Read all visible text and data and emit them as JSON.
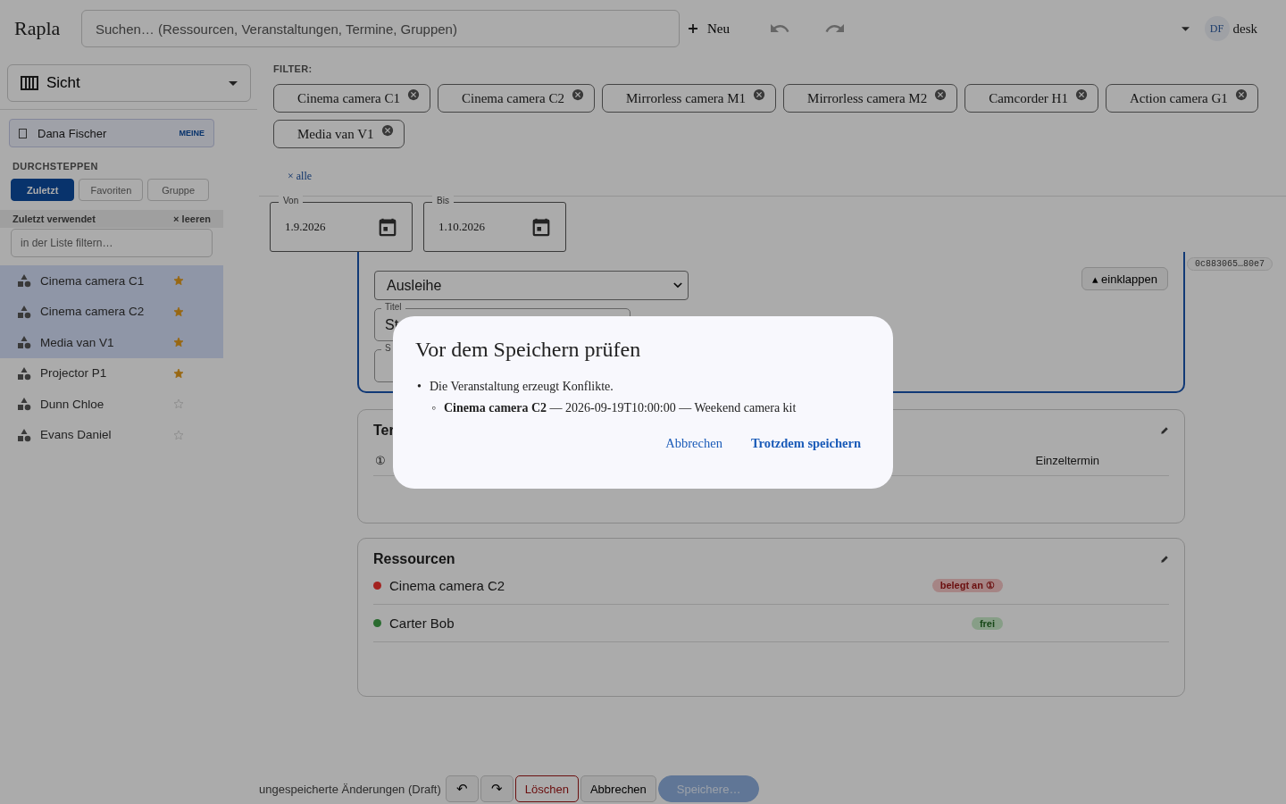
{
  "app": {
    "logo": "Rapla",
    "search_placeholder": "Suchen… (Ressourcen, Veranstaltungen, Termine, Gruppen)",
    "new_label": "Neu",
    "user_initials": "DF",
    "user_name": "desk"
  },
  "sidebar": {
    "view_label": "Sicht",
    "owner": {
      "name": "Dana Fischer",
      "badge": "MEINE",
      "checked": false
    },
    "browse_heading": "DURCHSTEPPEN",
    "browse_tabs": [
      {
        "label": "Zuletzt",
        "selected": true
      },
      {
        "label": "Favoriten",
        "selected": false
      },
      {
        "label": "Gruppe",
        "selected": false
      }
    ],
    "list_heading": "Zuletzt verwendet",
    "clear_label": "× leeren",
    "filter_placeholder": "in der Liste filtern…",
    "items": [
      {
        "name": "Cinema camera C1",
        "selected": true,
        "favorite": true
      },
      {
        "name": "Cinema camera C2",
        "selected": true,
        "favorite": true
      },
      {
        "name": "Media van V1",
        "selected": true,
        "favorite": true
      },
      {
        "name": "Projector P1",
        "selected": false,
        "favorite": true
      },
      {
        "name": "Dunn Chloe",
        "selected": false,
        "favorite": false
      },
      {
        "name": "Evans Daniel",
        "selected": false,
        "favorite": false
      }
    ]
  },
  "filter": {
    "heading": "FILTER:",
    "chips": [
      "Cinema camera C1",
      "Cinema camera C2",
      "Mirrorless camera M1",
      "Mirrorless camera M2",
      "Camcorder H1",
      "Action camera G1",
      "Media van V1"
    ],
    "clear_all": "× alle"
  },
  "dates": [
    {
      "label": "Von",
      "value": "1.9.2026"
    },
    {
      "label": "Bis",
      "value": "1.10.2026"
    }
  ],
  "editor": {
    "type_value": "Ausleihe",
    "title_label": "Titel",
    "title_value": "St",
    "field3_label": "S",
    "collapse_label": "▴ einklappen",
    "id_badge": "0c883065…80e7"
  },
  "appointments": {
    "heading": "Ter",
    "rows": [
      {
        "text": "①",
        "kind": "Einzeltermin"
      }
    ]
  },
  "resources": {
    "heading": "Ressourcen",
    "rows": [
      {
        "name": "Cinema camera C2",
        "status": "belegt an ①",
        "busy": true,
        "color": "#a3221f"
      },
      {
        "name": "Carter Bob",
        "status": "frei",
        "busy": false,
        "color": "#2a6b2f"
      }
    ]
  },
  "footer": {
    "status": "ungespeicherte Änderungen (Draft)",
    "undo": "↶",
    "redo": "↷",
    "delete": "Löschen",
    "cancel": "Abbrechen",
    "save": "Speichere…"
  },
  "dialog": {
    "title": "Vor dem Speichern prüfen",
    "bullet": "•",
    "message": "Die Veranstaltung erzeugt Konflikte.",
    "sub_bullet": "◦",
    "conflicts": [
      "**Cinema camera C2** — 2026-09-19T10:00:00 — Weekend camera kit"
    ],
    "cancel": "Abbrechen",
    "confirm": "Trotzdem speichern"
  }
}
